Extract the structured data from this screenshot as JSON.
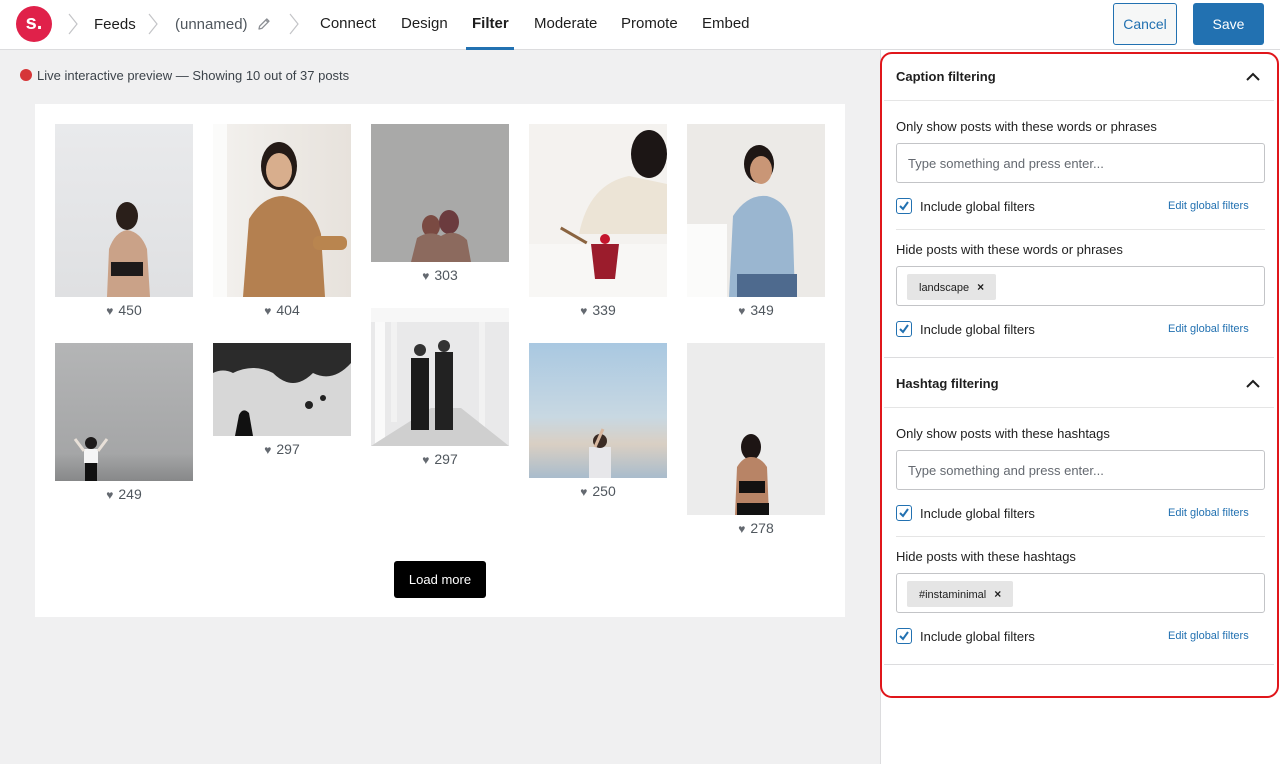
{
  "header": {
    "logo_text": "s.",
    "breadcrumbs": [
      "Feeds",
      "(unnamed)"
    ],
    "tabs": [
      "Connect",
      "Design",
      "Filter",
      "Moderate",
      "Promote",
      "Embed"
    ],
    "active_tab": "Filter",
    "cancel_label": "Cancel",
    "save_label": "Save"
  },
  "preview": {
    "status": "Live interactive preview — Showing 10 out of 37 posts",
    "posts": [
      {
        "likes": "450"
      },
      {
        "likes": "404"
      },
      {
        "likes": "303"
      },
      {
        "likes": "339"
      },
      {
        "likes": "349"
      },
      {
        "likes": "249"
      },
      {
        "likes": "297"
      },
      {
        "likes": "297"
      },
      {
        "likes": "250"
      },
      {
        "likes": "278"
      }
    ],
    "load_more_label": "Load more"
  },
  "sidebar": {
    "caption": {
      "title": "Caption filtering",
      "show_label": "Only show posts with these words or phrases",
      "show_placeholder": "Type something and press enter...",
      "include_global_1": "Include global filters",
      "edit_global_1": "Edit global filters",
      "hide_label": "Hide posts with these words or phrases",
      "hide_tags": [
        "landscape"
      ],
      "include_global_2": "Include global filters",
      "edit_global_2": "Edit global filters"
    },
    "hashtag": {
      "title": "Hashtag filtering",
      "show_label": "Only show posts with these hashtags",
      "show_placeholder": "Type something and press enter...",
      "include_global_1": "Include global filters",
      "edit_global_1": "Edit global filters",
      "hide_label": "Hide posts with these hashtags",
      "hide_tags": [
        "#instaminimal"
      ],
      "include_global_2": "Include global filters",
      "edit_global_2": "Edit global filters"
    },
    "tag_remove_symbol": "×"
  },
  "colors": {
    "accent": "#2271b1",
    "brand": "#e0214a",
    "live": "#d63638",
    "highlight": "#e0161b"
  }
}
